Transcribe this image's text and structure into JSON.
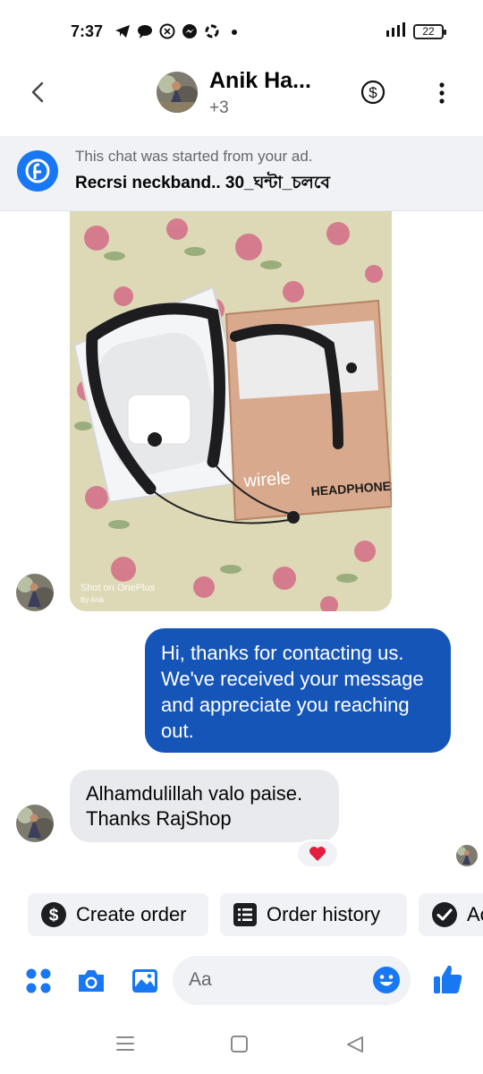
{
  "status_bar": {
    "time": "7:37",
    "battery": "22"
  },
  "header": {
    "name": "Anik Ha...",
    "subtitle": "+3"
  },
  "ad_banner": {
    "line1": "This chat was started from your ad.",
    "line2": "Recrsi neckband.. 30_ঘন্টা_চলবে"
  },
  "photo": {
    "watermark_line1": "Shot on OnePlus",
    "watermark_line2": "By Anik"
  },
  "messages": [
    {
      "side": "outgoing",
      "text": "Hi, thanks for contacting us. We've received your message and appreciate you reaching out."
    },
    {
      "side": "incoming",
      "text": "Alhamdulillah valo paise. Thanks RajShop",
      "reaction": "heart"
    }
  ],
  "quick_actions": [
    {
      "label": "Create order",
      "icon": "dollar-icon"
    },
    {
      "label": "Order history",
      "icon": "list-icon"
    },
    {
      "label": "Ac",
      "icon": "check-circle-icon"
    }
  ],
  "composer": {
    "placeholder": "Aa"
  },
  "colors": {
    "accent": "#1877f2",
    "outgoing_bubble": "#1655b8",
    "incoming_bubble": "#e9eaed",
    "banner_bg": "#f0f2f5"
  }
}
